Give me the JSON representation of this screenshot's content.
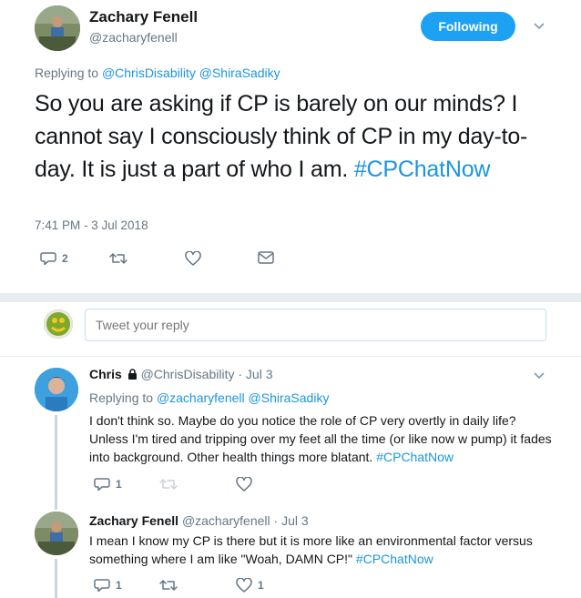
{
  "main_tweet": {
    "name": "Zachary Fenell",
    "handle": "@zacharyfenell",
    "follow_label": "Following",
    "replying_prefix": "Replying to",
    "replying_to": [
      "@ChrisDisability",
      "@ShiraSadiky"
    ],
    "text": "So you are asking if CP is barely on our minds? I cannot say I consciously think of CP in my day-to-day. It is just a part of who I am.",
    "hashtag": "#CPChatNow",
    "timestamp": "7:41 PM - 3 Jul 2018",
    "reply_count": "2",
    "retweet_count": "",
    "like_count": ""
  },
  "compose": {
    "placeholder": "Tweet your reply"
  },
  "replies": [
    {
      "name": "Chris",
      "handle": "@ChrisDisability",
      "date": "· Jul 3",
      "protected": true,
      "replying_prefix": "Replying to",
      "replying_to": [
        "@zacharyfenell",
        "@ShiraSadiky"
      ],
      "text": "I don't think so. Maybe do you notice the role of CP very overtly in daily life? Unless I'm tired and tripping over my feet all the time (or like now w pump) it fades into background. Other health things more blatant.",
      "hashtag": "#CPChatNow",
      "reply_count": "1",
      "retweet_count": "",
      "like_count": ""
    },
    {
      "name": "Zachary Fenell",
      "handle": "@zacharyfenell",
      "date": "· Jul 3",
      "text": "I mean I know my CP is there but it is more like an environmental factor versus something where I am like \"Woah, DAMN CP!\"",
      "hashtag": "#CPChatNow",
      "reply_count": "1",
      "retweet_count": "",
      "like_count": "1"
    }
  ],
  "colors": {
    "link": "#1b95e0",
    "button": "#1da1f2",
    "muted": "#657786",
    "divider": "#e6ecf0"
  },
  "icons": [
    "chevron-down-icon",
    "reply-icon",
    "retweet-icon",
    "like-icon",
    "message-icon",
    "lock-icon"
  ]
}
